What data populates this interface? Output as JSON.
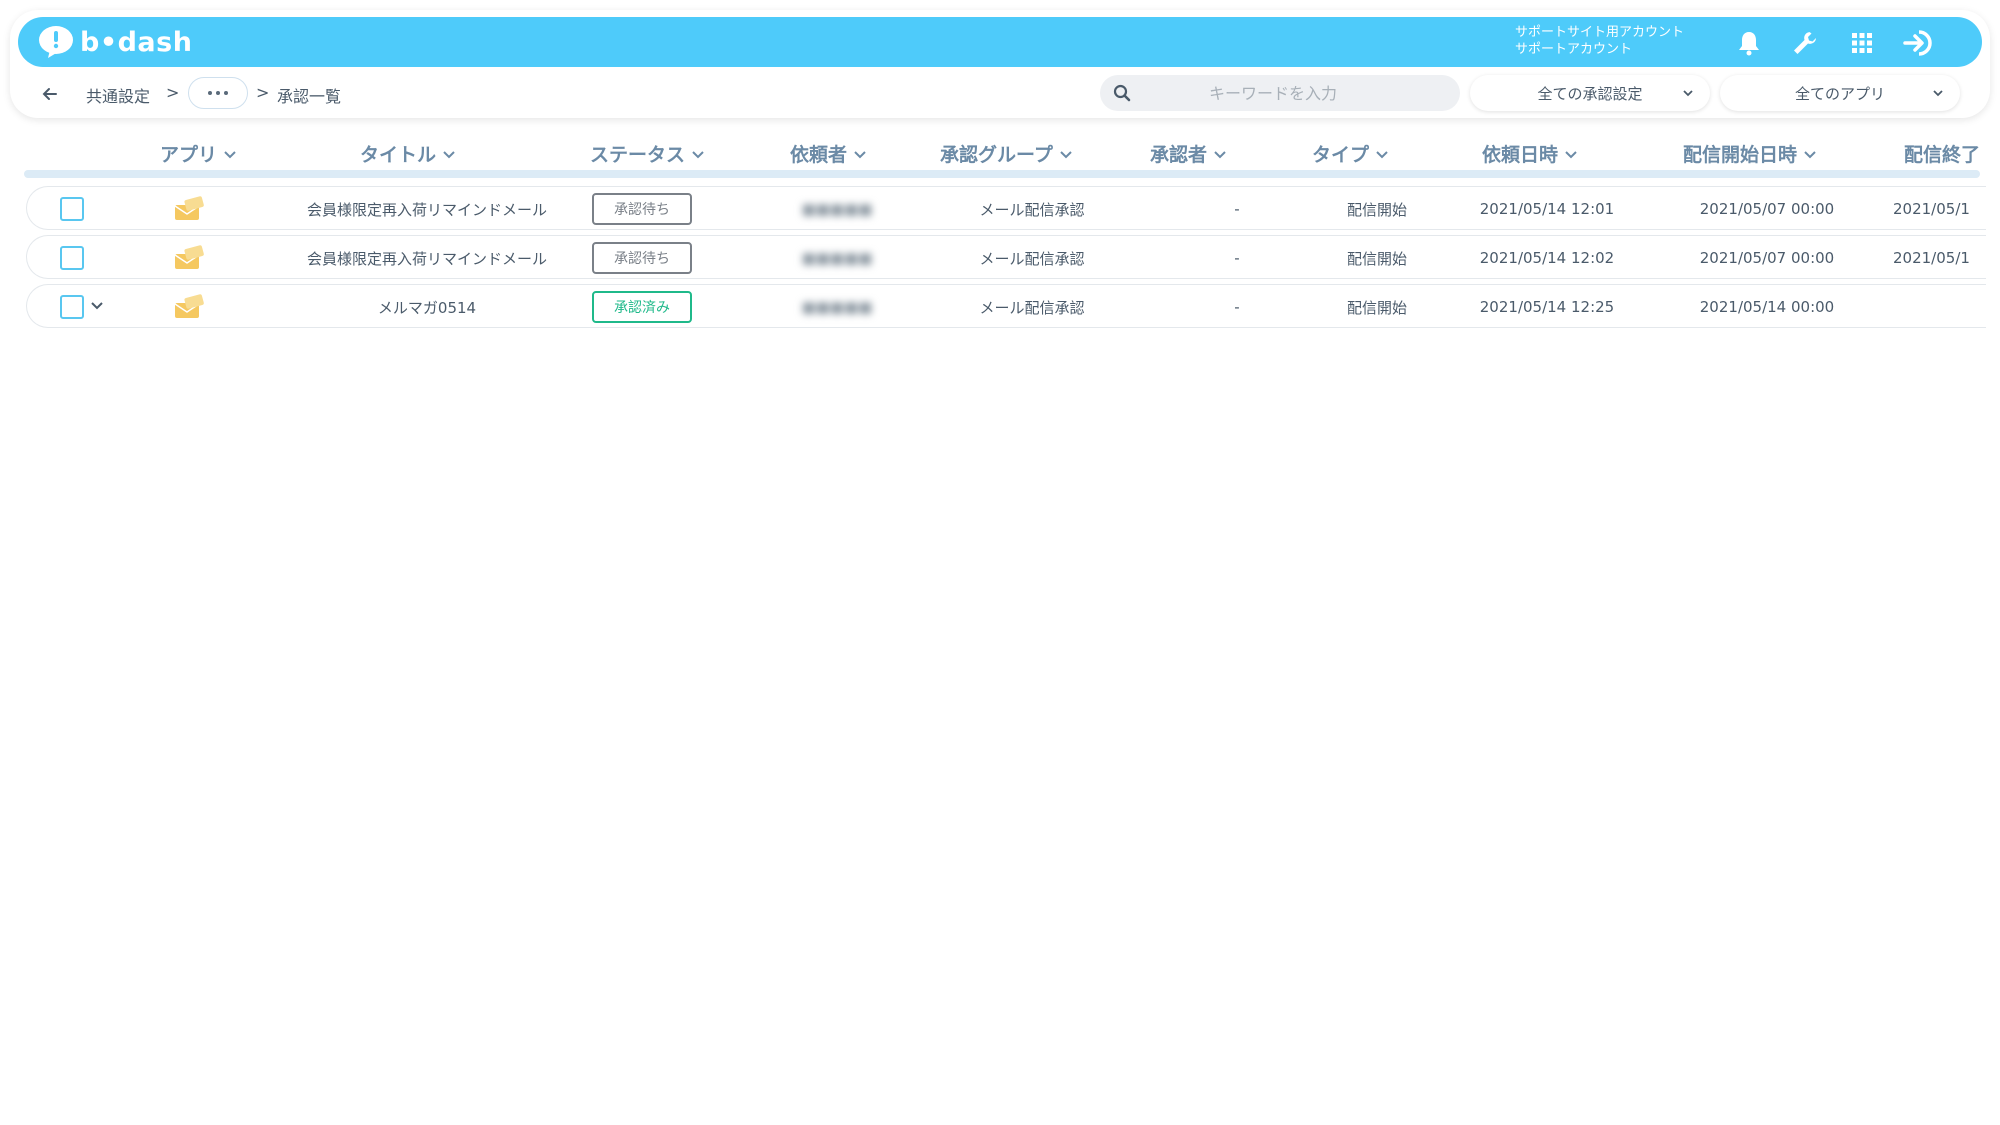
{
  "header": {
    "logo_text": "b•dash",
    "account_line1": "サポートサイト用アカウント",
    "account_line2": "サポートアカウント",
    "icons": [
      "bell-icon",
      "wrench-icon",
      "apps-grid-icon",
      "logout-icon"
    ],
    "brand_color": "#4ecbfa"
  },
  "breadcrumb": {
    "item1": "共通設定",
    "sep": ">",
    "current": "承認一覧"
  },
  "search": {
    "placeholder": "キーワードを入力",
    "value": ""
  },
  "filters": {
    "approval_setting": "全ての承認設定",
    "app": "全てのアプリ"
  },
  "table": {
    "columns": [
      "アプリ",
      "タイトル",
      "ステータス",
      "依頼者",
      "承認グループ",
      "承認者",
      "タイプ",
      "依頼日時",
      "配信開始日時",
      "配信終了"
    ],
    "rows": [
      {
        "title": "会員様限定再入荷リマインドメール",
        "status": "承認待ち",
        "status_kind": "wait",
        "requester": "■■■■■",
        "group": "メール配信承認",
        "approver": "-",
        "type": "配信開始",
        "requested_at": "2021/05/14 12:01",
        "start_at": "2021/05/07 00:00",
        "end_at": "2021/05/1",
        "expandable": false
      },
      {
        "title": "会員様限定再入荷リマインドメール",
        "status": "承認待ち",
        "status_kind": "wait",
        "requester": "■■■■■",
        "group": "メール配信承認",
        "approver": "-",
        "type": "配信開始",
        "requested_at": "2021/05/14 12:02",
        "start_at": "2021/05/07 00:00",
        "end_at": "2021/05/1",
        "expandable": false
      },
      {
        "title": "メルマガ0514",
        "status": "承認済み",
        "status_kind": "done",
        "requester": "■■■■■",
        "group": "メール配信承認",
        "approver": "-",
        "type": "配信開始",
        "requested_at": "2021/05/14 12:25",
        "start_at": "2021/05/14 00:00",
        "end_at": "",
        "expandable": true
      }
    ]
  },
  "colors": {
    "wait": "#7a8088",
    "done": "#1fb98a",
    "header_text": "#6b8aa6"
  }
}
